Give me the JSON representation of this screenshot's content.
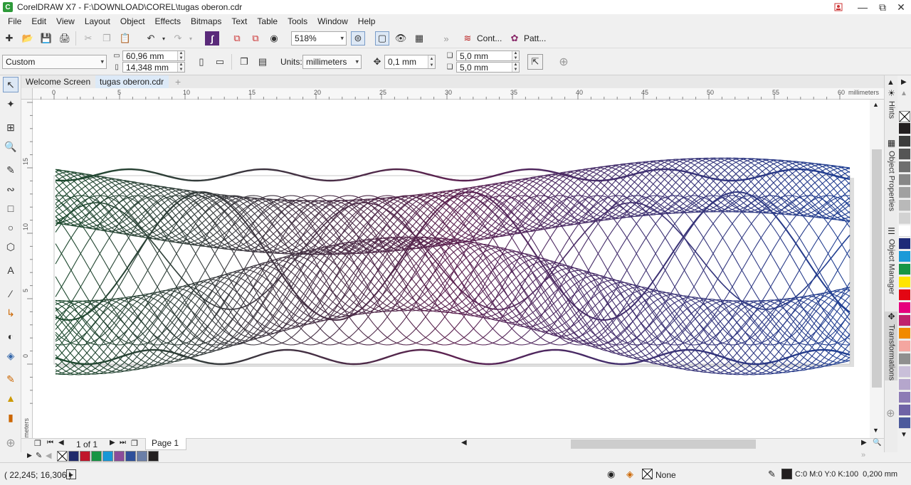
{
  "window": {
    "title": "CorelDRAW X7 - F:\\DOWNLOAD\\COREL\\tugas oberon.cdr",
    "app_icon_glyph": "C"
  },
  "menu": [
    "File",
    "Edit",
    "View",
    "Layout",
    "Object",
    "Effects",
    "Bitmaps",
    "Text",
    "Table",
    "Tools",
    "Window",
    "Help"
  ],
  "standard_toolbar": {
    "zoom_value": "518%",
    "contour_label": "Cont...",
    "pattern_label": "Patt..."
  },
  "property_bar": {
    "page_preset": "Custom",
    "width": "60,96 mm",
    "height": "14,348 mm",
    "units_label": "Units:",
    "units_value": "millimeters",
    "nudge": "0,1 mm",
    "duplicate_x": "5,0 mm",
    "duplicate_y": "5,0 mm"
  },
  "tabs": [
    {
      "label": "Welcome Screen",
      "active": false
    },
    {
      "label": "tugas oberon.cdr",
      "active": true
    }
  ],
  "ruler": {
    "h_labels": [
      "0",
      "5",
      "10",
      "15",
      "20",
      "25",
      "30",
      "35",
      "40",
      "45",
      "50",
      "55",
      "60"
    ],
    "h_units": "millimeters",
    "v_labels": [
      "15",
      "10",
      "5",
      "0"
    ],
    "v_units": "millimeters"
  },
  "page_nav": {
    "counter": "1 of 1",
    "page_tab": "Page 1"
  },
  "document_palette": [
    "#1f2a6b",
    "#c0172b",
    "#169544",
    "#1897d6",
    "#8b4c9a",
    "#2e4f9a",
    "#6b7fa8",
    "#231f20"
  ],
  "color_palette": [
    "#231f20",
    "#3c3c3c",
    "#555555",
    "#6e6e6e",
    "#878787",
    "#a0a0a0",
    "#b9b9b9",
    "#d2d2d2",
    "#ffffff",
    "#1e2a78",
    "#1a9ad8",
    "#169544",
    "#ffe500",
    "#e30613",
    "#e6007e",
    "#c0236d",
    "#f18a00",
    "#f4a6a0",
    "#8f8f8f",
    "#c9bfd9",
    "#b5a6cc",
    "#8d7bb5",
    "#6f63a6",
    "#4c5a9c"
  ],
  "dockers": [
    "Hints",
    "Object Properties",
    "Object Manager",
    "Transformations"
  ],
  "status": {
    "coords": "( 22,245; 16,306 )",
    "fill_label": "None",
    "outline_info": "C:0 M:0 Y:0 K:100  0,200 mm"
  },
  "artwork": {
    "gradient_colors": [
      "#1c4a2e",
      "#5c2150",
      "#1e3f93"
    ]
  }
}
